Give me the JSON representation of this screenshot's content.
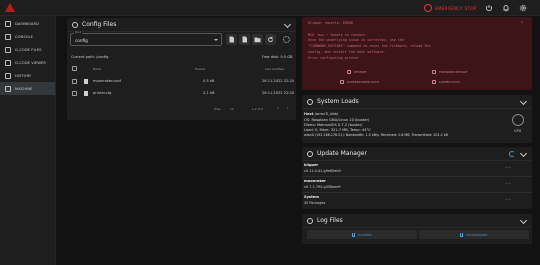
{
  "topbar": {
    "estop_label": "EMERGENCY STOP"
  },
  "sidebar": {
    "items": [
      {
        "label": "DASHBOARD"
      },
      {
        "label": "CONSOLE"
      },
      {
        "label": "G-CODE FILES"
      },
      {
        "label": "G-CODE VIEWER"
      },
      {
        "label": "HISTORY"
      },
      {
        "label": "MACHINE"
      }
    ],
    "active_index": 5
  },
  "config_files": {
    "title": "Config Files",
    "root_label": "Root",
    "root_value": "config",
    "current_path": "Current path: /config",
    "free_disk": "Free disk: 9.5 GB",
    "columns": {
      "name": "Name",
      "filesize": "Filesize",
      "last_modified": "Last modified"
    },
    "files": [
      {
        "name": "moonraker.conf",
        "size": "0.5 kB",
        "modified": "26.11.2022 22:20"
      },
      {
        "name": "printer.cfg",
        "size": "2.1 kB",
        "modified": "26.11.2022 22:20"
      }
    ],
    "pager": {
      "files_label": "Files:",
      "per_page": "10",
      "range": "1-2 of 2"
    }
  },
  "warning": {
    "text": "Klipper reports: ERROR\n\nMCU 'mcu': Unable to connect\nOnce the underlying issue is corrected, use the\n\"FIRMWARE_RESTART\" command to reset the firmware, reload the\nconfig, and restart the host software.\nError configuring printer",
    "buttons": [
      "RESTART",
      "FIRMWARE RESTART",
      "KLIPPERSCREEN DOCS",
      "KLIPPER DOCS"
    ]
  },
  "system_loads": {
    "title": "System Loads",
    "host_label": "Host",
    "host_name": "(armv7l_bbb)",
    "os_line": "OS: Raspbian GNU/Linux 10 (buster)",
    "distro_line": "Distro: MainsailOS 0.7.2 (buster)",
    "load_line": "Load: 0, Mem: 321.7 MB, Temp: 44°C",
    "wlan_line": "wlan0 (192.168.178.51): Bandwidth: 1.5 kB/s, Received: 2.6 MB, Transmitted: 201.2 kB",
    "cpu_label": "CPU"
  },
  "update_manager": {
    "title": "Update Manager",
    "entries": [
      {
        "name": "klipper",
        "version": "v0.11.0-41-g9e60ab9"
      },
      {
        "name": "moonraker",
        "version": "v0.7.1-795-g358aee9"
      },
      {
        "name": "System",
        "version": "30 Packages"
      }
    ]
  },
  "log_files": {
    "title": "Log Files",
    "klipper_label": "KLIPPER",
    "moonraker_label": "MOONRAKER"
  },
  "colors": {
    "accent": "#4a9fd8",
    "danger": "#e53935",
    "warn_bg": "#3d1418"
  }
}
